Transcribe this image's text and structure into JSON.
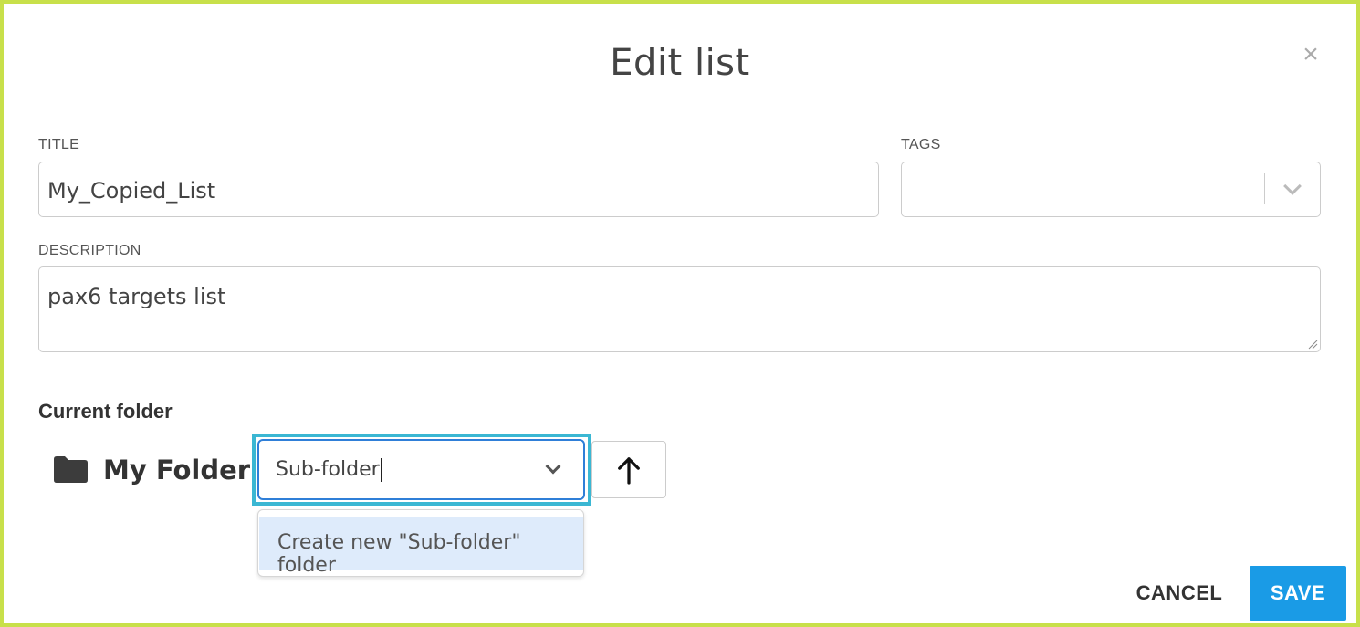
{
  "dialog": {
    "title": "Edit list",
    "close_icon": "close-icon"
  },
  "form": {
    "title_label": "TITLE",
    "title_value": "My_Copied_List",
    "tags_label": "TAGS",
    "tags_value": "",
    "description_label": "DESCRIPTION",
    "description_value": "pax6 targets list"
  },
  "folder": {
    "heading": "Current folder",
    "icon": "folder-icon",
    "path": "My Folder /",
    "input_value": "Sub-folder",
    "dropdown_icon": "chevron-down-icon",
    "up_icon": "arrow-up-icon",
    "dropdown_option": "Create new \"Sub-folder\" folder"
  },
  "actions": {
    "cancel_label": "CANCEL",
    "save_label": "SAVE"
  },
  "colors": {
    "accent": "#1a9be6",
    "focus_ring": "#3bb7d3",
    "frame_border": "#c8e04a",
    "option_highlight": "#deebfb"
  }
}
